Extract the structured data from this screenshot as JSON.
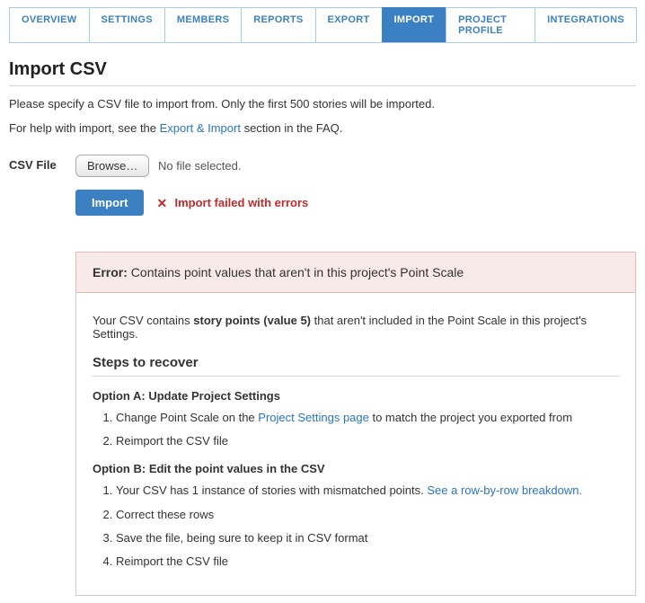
{
  "tabs": [
    {
      "label": "OVERVIEW",
      "active": false
    },
    {
      "label": "SETTINGS",
      "active": false
    },
    {
      "label": "MEMBERS",
      "active": false
    },
    {
      "label": "REPORTS",
      "active": false
    },
    {
      "label": "EXPORT",
      "active": false
    },
    {
      "label": "IMPORT",
      "active": true
    },
    {
      "label": "PROJECT PROFILE",
      "active": false
    },
    {
      "label": "INTEGRATIONS",
      "active": false
    }
  ],
  "page_title": "Import CSV",
  "intro1": "Please specify a CSV file to import from. Only the first 500 stories will be imported.",
  "intro2_pre": "For help with import, see the ",
  "intro2_link": "Export & Import",
  "intro2_post": " section in the FAQ.",
  "form": {
    "label": "CSV File",
    "browse_label": "Browse…",
    "file_status": "No file selected.",
    "import_label": "Import",
    "fail_text": "Import failed with errors"
  },
  "error": {
    "label": "Error:",
    "headline": "Contains point values that aren't in this project's Point Scale",
    "detail_pre": "Your CSV contains ",
    "detail_bold": "story points (value 5)",
    "detail_post": " that aren't included in the Point Scale in this project's Settings.",
    "recover_heading": "Steps to recover",
    "optionA_heading": "Option A: Update Project Settings",
    "optionA_steps": {
      "s1_pre": "Change Point Scale on the ",
      "s1_link": "Project Settings page",
      "s1_post": " to match the project you exported from",
      "s2": "Reimport the CSV file"
    },
    "optionB_heading": "Option B: Edit the point values in the CSV",
    "optionB_steps": {
      "s1_pre": "Your CSV has 1 instance of stories with mismatched points. ",
      "s1_link": "See a row-by-row breakdown.",
      "s2": "Correct these rows",
      "s3": "Save the file, being sure to keep it in CSV format",
      "s4": "Reimport the CSV file"
    }
  }
}
